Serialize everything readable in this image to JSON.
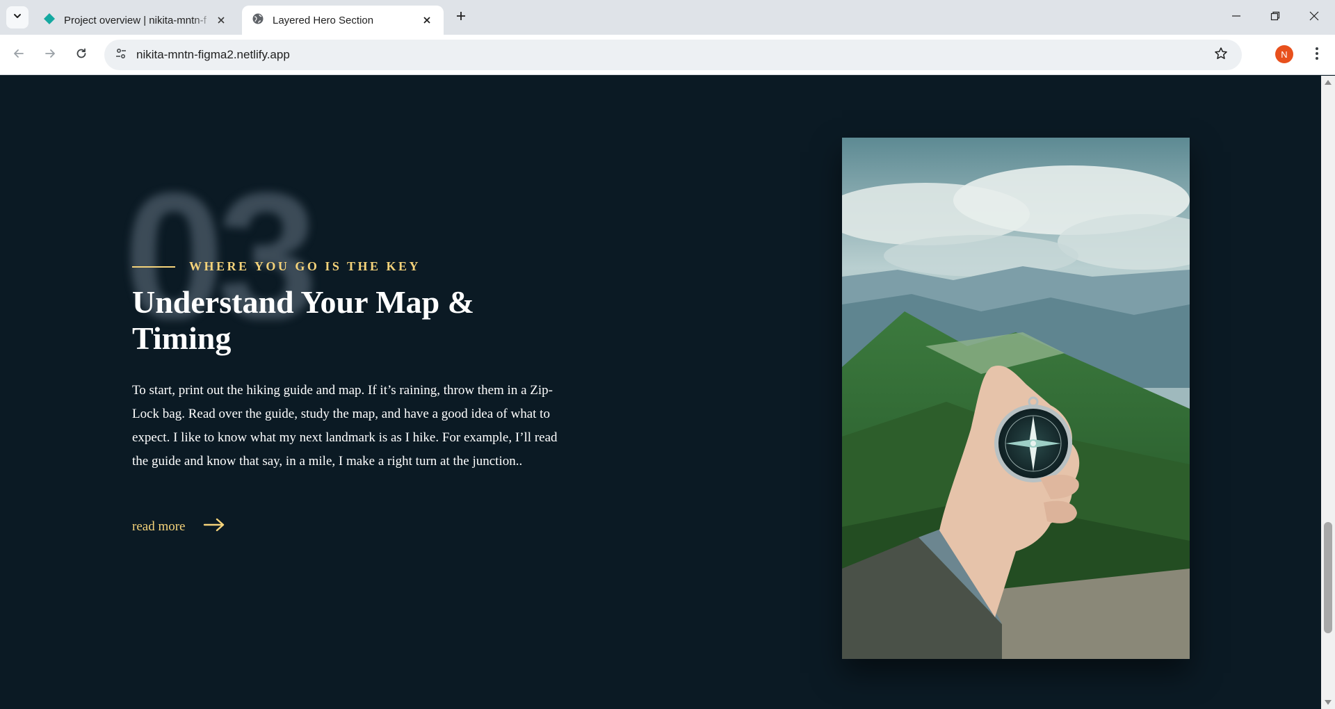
{
  "browser": {
    "tabs": [
      {
        "title": "Project overview | nikita-mntn-f",
        "active": false,
        "favicon": "netlify-diamond-icon"
      },
      {
        "title": "Layered Hero Section",
        "active": true,
        "favicon": "globe-icon"
      }
    ],
    "url": "nikita-mntn-figma2.netlify.app",
    "profile_initial": "N",
    "colors": {
      "profile": "#e8501c",
      "accent": "#f5d37a",
      "page_bg": "#0b1a24"
    }
  },
  "section": {
    "number": "03",
    "eyebrow": "WHERE YOU GO IS THE KEY",
    "heading": "Understand Your Map & Timing",
    "body": "To start, print out the hiking guide and map. If it’s raining, throw them in a Zip-Lock bag. Read over the guide, study the map, and have a good idea of what to expect. I like to know what my next landmark is as I hike. For example, I’ll read the guide and know that say, in a mile, I make a right turn at the junction..",
    "read_more": "read more",
    "image_subject": "hand holding compass over mountain ridge"
  }
}
